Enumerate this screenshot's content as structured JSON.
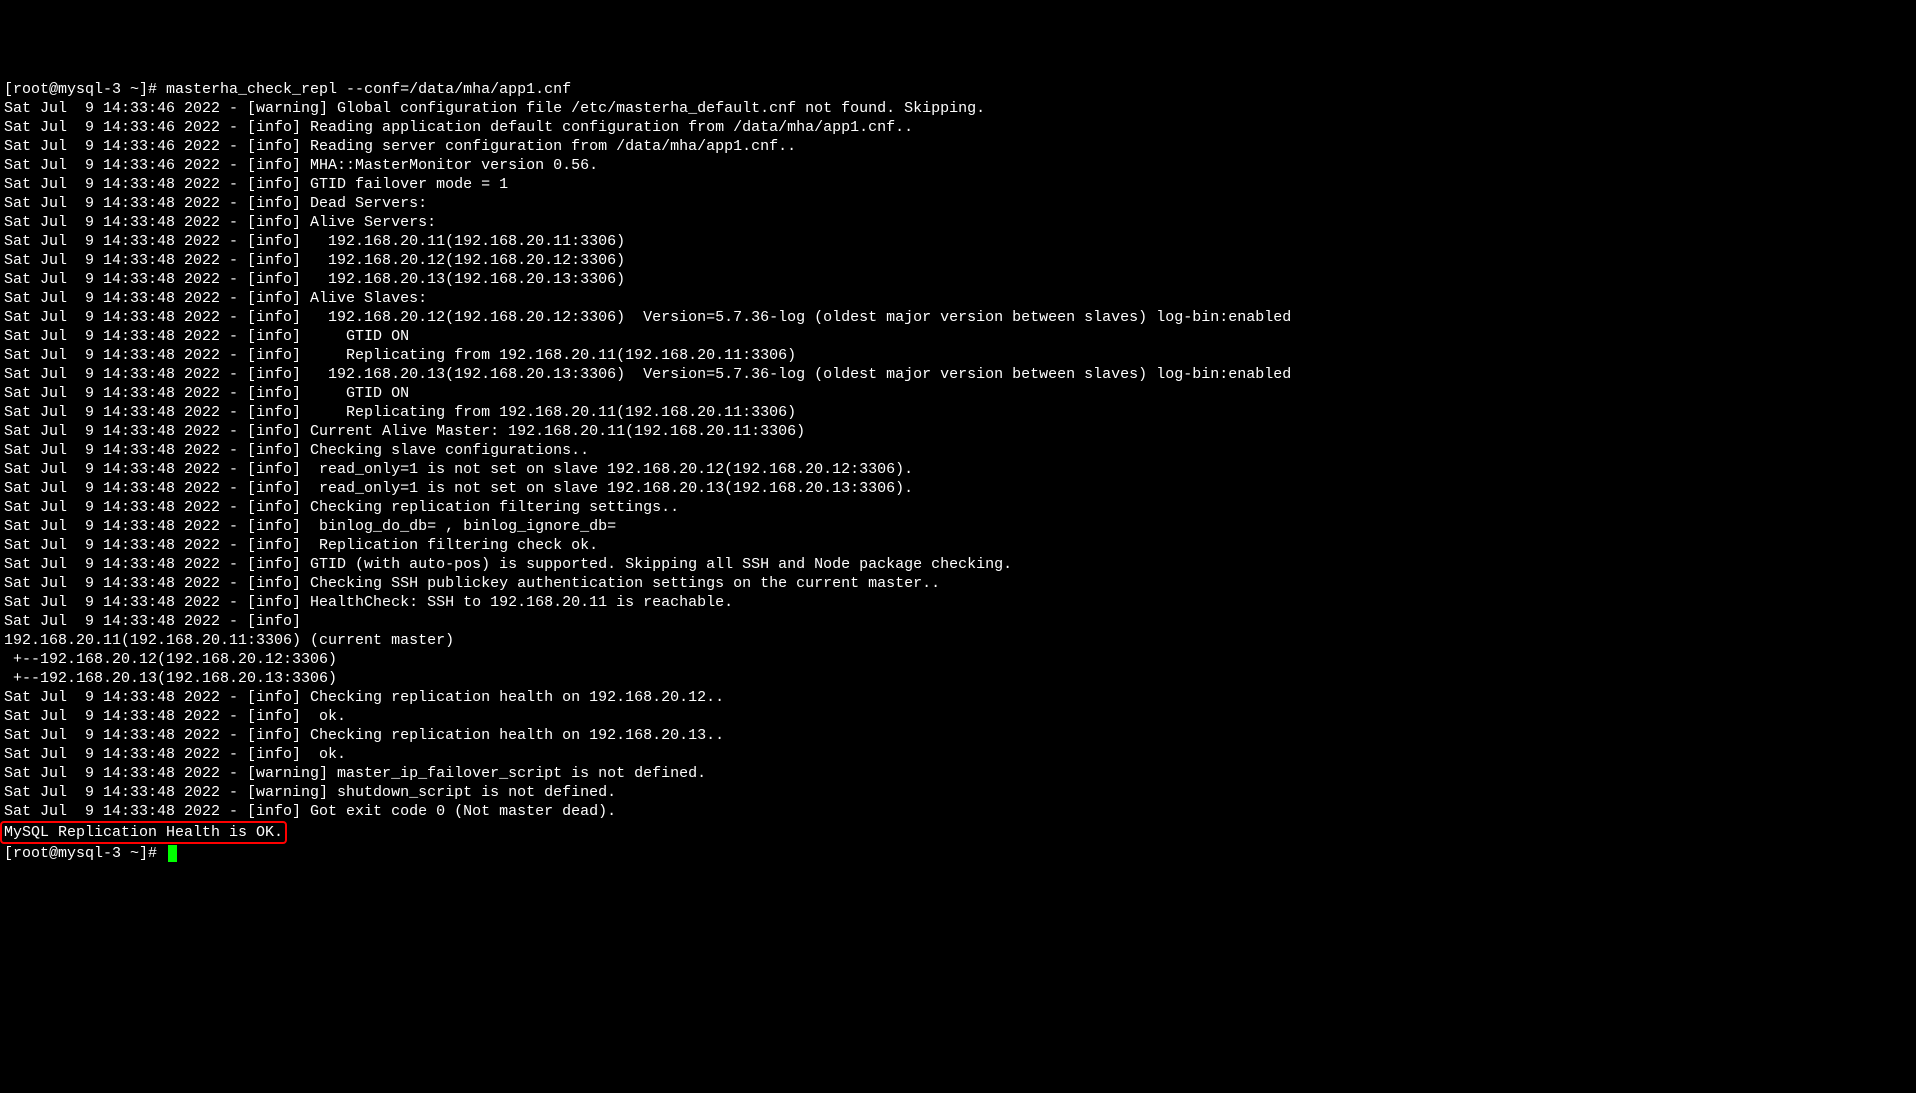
{
  "prompt1": "[root@mysql-3 ~]# ",
  "command1": "masterha_check_repl --conf=/data/mha/app1.cnf",
  "lines": [
    "Sat Jul  9 14:33:46 2022 - [warning] Global configuration file /etc/masterha_default.cnf not found. Skipping.",
    "Sat Jul  9 14:33:46 2022 - [info] Reading application default configuration from /data/mha/app1.cnf..",
    "Sat Jul  9 14:33:46 2022 - [info] Reading server configuration from /data/mha/app1.cnf..",
    "Sat Jul  9 14:33:46 2022 - [info] MHA::MasterMonitor version 0.56.",
    "Sat Jul  9 14:33:48 2022 - [info] GTID failover mode = 1",
    "Sat Jul  9 14:33:48 2022 - [info] Dead Servers:",
    "Sat Jul  9 14:33:48 2022 - [info] Alive Servers:",
    "Sat Jul  9 14:33:48 2022 - [info]   192.168.20.11(192.168.20.11:3306)",
    "Sat Jul  9 14:33:48 2022 - [info]   192.168.20.12(192.168.20.12:3306)",
    "Sat Jul  9 14:33:48 2022 - [info]   192.168.20.13(192.168.20.13:3306)",
    "Sat Jul  9 14:33:48 2022 - [info] Alive Slaves:",
    "Sat Jul  9 14:33:48 2022 - [info]   192.168.20.12(192.168.20.12:3306)  Version=5.7.36-log (oldest major version between slaves) log-bin:enabled",
    "Sat Jul  9 14:33:48 2022 - [info]     GTID ON",
    "Sat Jul  9 14:33:48 2022 - [info]     Replicating from 192.168.20.11(192.168.20.11:3306)",
    "Sat Jul  9 14:33:48 2022 - [info]   192.168.20.13(192.168.20.13:3306)  Version=5.7.36-log (oldest major version between slaves) log-bin:enabled",
    "Sat Jul  9 14:33:48 2022 - [info]     GTID ON",
    "Sat Jul  9 14:33:48 2022 - [info]     Replicating from 192.168.20.11(192.168.20.11:3306)",
    "Sat Jul  9 14:33:48 2022 - [info] Current Alive Master: 192.168.20.11(192.168.20.11:3306)",
    "Sat Jul  9 14:33:48 2022 - [info] Checking slave configurations..",
    "Sat Jul  9 14:33:48 2022 - [info]  read_only=1 is not set on slave 192.168.20.12(192.168.20.12:3306).",
    "Sat Jul  9 14:33:48 2022 - [info]  read_only=1 is not set on slave 192.168.20.13(192.168.20.13:3306).",
    "Sat Jul  9 14:33:48 2022 - [info] Checking replication filtering settings..",
    "Sat Jul  9 14:33:48 2022 - [info]  binlog_do_db= , binlog_ignore_db= ",
    "Sat Jul  9 14:33:48 2022 - [info]  Replication filtering check ok.",
    "Sat Jul  9 14:33:48 2022 - [info] GTID (with auto-pos) is supported. Skipping all SSH and Node package checking.",
    "Sat Jul  9 14:33:48 2022 - [info] Checking SSH publickey authentication settings on the current master..",
    "Sat Jul  9 14:33:48 2022 - [info] HealthCheck: SSH to 192.168.20.11 is reachable.",
    "Sat Jul  9 14:33:48 2022 - [info] ",
    "192.168.20.11(192.168.20.11:3306) (current master)",
    " +--192.168.20.12(192.168.20.12:3306)",
    " +--192.168.20.13(192.168.20.13:3306)",
    "",
    "Sat Jul  9 14:33:48 2022 - [info] Checking replication health on 192.168.20.12..",
    "Sat Jul  9 14:33:48 2022 - [info]  ok.",
    "Sat Jul  9 14:33:48 2022 - [info] Checking replication health on 192.168.20.13..",
    "Sat Jul  9 14:33:48 2022 - [info]  ok.",
    "Sat Jul  9 14:33:48 2022 - [warning] master_ip_failover_script is not defined.",
    "Sat Jul  9 14:33:48 2022 - [warning] shutdown_script is not defined.",
    "Sat Jul  9 14:33:48 2022 - [info] Got exit code 0 (Not master dead).",
    ""
  ],
  "highlighted": "MySQL Replication Health is OK.",
  "prompt2": "[root@mysql-3 ~]# "
}
